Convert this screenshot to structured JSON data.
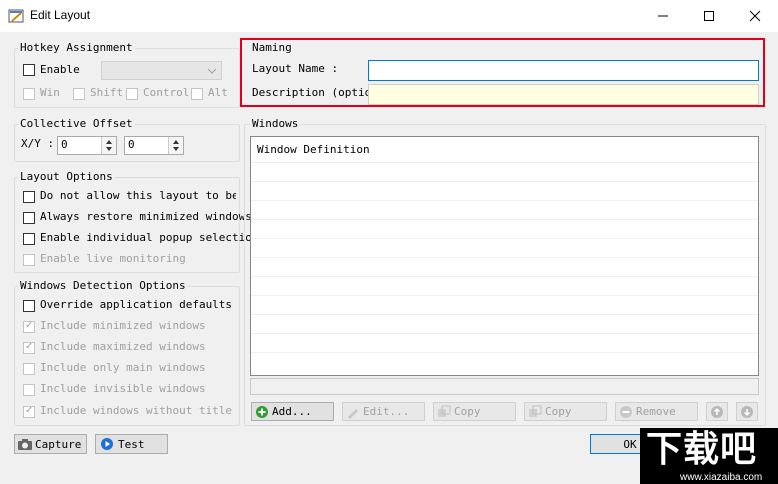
{
  "window": {
    "title": "Edit Layout"
  },
  "hotkey": {
    "legend": "Hotkey Assignment",
    "enable_label": "Enable",
    "modifiers": [
      "Win",
      "Shift",
      "Control",
      "Alt"
    ]
  },
  "offset": {
    "legend": "Collective Offset",
    "label": "X/Y :",
    "x": "0",
    "y": "0"
  },
  "layout_options": {
    "legend": "Layout Options",
    "items": [
      "Do not allow this layout to be ap",
      "Always restore minimized windows",
      "Enable individual popup selection",
      "Enable live monitoring"
    ]
  },
  "detection": {
    "legend": "Windows Detection Options",
    "items": [
      "Override application defaults",
      "Include minimized windows",
      "Include maximized windows",
      "Include only main windows",
      "Include invisible windows",
      "Include windows without title"
    ]
  },
  "naming": {
    "legend": "Naming",
    "layout_name_label": "Layout Name :",
    "layout_name_value": "",
    "description_label": "Description (optional) :",
    "description_value": ""
  },
  "windows": {
    "legend": "Windows",
    "column_header": "Window Definition",
    "buttons": {
      "add": "Add...",
      "edit": "Edit...",
      "copy1": "Copy",
      "copy2": "Copy",
      "remove": "Remove"
    }
  },
  "bottom": {
    "capture": "Capture",
    "test": "Test",
    "ok": "OK"
  },
  "watermark": {
    "text": "下载吧",
    "url": "www.xiazaiba.com"
  },
  "colors": {
    "highlight": "#e0001b",
    "focus": "#0078d7",
    "description_bg": "#ffffe1"
  }
}
